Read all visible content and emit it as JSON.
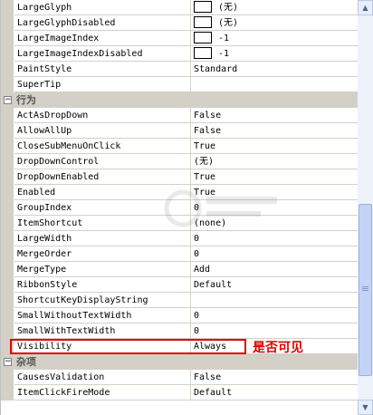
{
  "rows": [
    {
      "type": "prop",
      "name": "LargeGlyph",
      "value": "(无)",
      "swatch": true
    },
    {
      "type": "prop",
      "name": "LargeGlyphDisabled",
      "value": "(无)",
      "swatch": true
    },
    {
      "type": "prop",
      "name": "LargeImageIndex",
      "value": "-1",
      "swatch": true
    },
    {
      "type": "prop",
      "name": "LargeImageIndexDisabled",
      "value": "-1",
      "swatch": true
    },
    {
      "type": "prop",
      "name": "PaintStyle",
      "value": "Standard"
    },
    {
      "type": "prop",
      "name": "SuperTip",
      "value": ""
    },
    {
      "type": "category",
      "name": "行为"
    },
    {
      "type": "prop",
      "name": "ActAsDropDown",
      "value": "False"
    },
    {
      "type": "prop",
      "name": "AllowAllUp",
      "value": "False"
    },
    {
      "type": "prop",
      "name": "CloseSubMenuOnClick",
      "value": "True"
    },
    {
      "type": "prop",
      "name": "DropDownControl",
      "value": "(无)"
    },
    {
      "type": "prop",
      "name": "DropDownEnabled",
      "value": "True"
    },
    {
      "type": "prop",
      "name": "Enabled",
      "value": "True"
    },
    {
      "type": "prop",
      "name": "GroupIndex",
      "value": "0"
    },
    {
      "type": "prop",
      "name": "ItemShortcut",
      "value": "(none)"
    },
    {
      "type": "prop",
      "name": "LargeWidth",
      "value": "0"
    },
    {
      "type": "prop",
      "name": "MergeOrder",
      "value": "0"
    },
    {
      "type": "prop",
      "name": "MergeType",
      "value": "Add"
    },
    {
      "type": "prop",
      "name": "RibbonStyle",
      "value": "Default"
    },
    {
      "type": "prop",
      "name": "ShortcutKeyDisplayString",
      "value": ""
    },
    {
      "type": "prop",
      "name": "SmallWithoutTextWidth",
      "value": "0"
    },
    {
      "type": "prop",
      "name": "SmallWithTextWidth",
      "value": "0"
    },
    {
      "type": "prop",
      "name": "Visibility",
      "value": "Always"
    },
    {
      "type": "category",
      "name": "杂项"
    },
    {
      "type": "prop",
      "name": "CausesValidation",
      "value": "False"
    },
    {
      "type": "prop",
      "name": "ItemClickFireMode",
      "value": "Default"
    }
  ],
  "category_toggle": "−",
  "annotation": "是否可见",
  "colors": {
    "highlight": "#e00000",
    "gutter": "#d4d0c8",
    "scroll_track": "#eef2fb",
    "scroll_thumb": "#c3d4f7"
  }
}
